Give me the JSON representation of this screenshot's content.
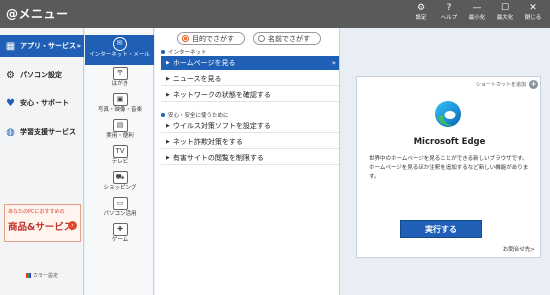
{
  "window": {
    "title": "@メニュー",
    "controls": [
      {
        "name": "settings",
        "label": "設定",
        "icon": "gear-icon"
      },
      {
        "name": "help",
        "label": "ヘルプ",
        "icon": "help-icon"
      },
      {
        "name": "minimize",
        "label": "最小化",
        "icon": "minimize-icon"
      },
      {
        "name": "maximize",
        "label": "最大化",
        "icon": "maximize-icon"
      },
      {
        "name": "close",
        "label": "閉じる",
        "icon": "close-icon"
      }
    ]
  },
  "categories": [
    {
      "label": "アプリ・サービス",
      "icon": "apps-grid-icon",
      "active": true
    },
    {
      "label": "パソコン設定",
      "icon": "gear-icon",
      "active": false
    },
    {
      "label": "安心・サポート",
      "icon": "heart-icon",
      "active": false
    },
    {
      "label": "学習支援サービス",
      "icon": "globe-icon",
      "active": false
    }
  ],
  "ad": {
    "top_text": "あなたのPCにおすすめの",
    "main_text": "商品&サービス",
    "arrow": "›"
  },
  "color_setting": "カラー設定",
  "subcategories": [
    {
      "label": "インターネット・メール",
      "icon": "globe-mail-icon",
      "active": true
    },
    {
      "label": "はがき",
      "icon": "postcard-icon",
      "active": false
    },
    {
      "label": "写真・映像・音楽",
      "icon": "photo-icon",
      "active": false
    },
    {
      "label": "実用・便利",
      "icon": "toolbox-icon",
      "active": false
    },
    {
      "label": "テレビ",
      "icon": "tv-icon",
      "active": false
    },
    {
      "label": "ショッピング",
      "icon": "cart-icon",
      "active": false
    },
    {
      "label": "パソコン活用",
      "icon": "pc-icon",
      "active": false
    },
    {
      "label": "ゲーム",
      "icon": "gamepad-icon",
      "active": false
    }
  ],
  "search_modes": {
    "purpose_label": "目的でさがす",
    "name_label": "名前でさがす",
    "selected": "purpose"
  },
  "sections": [
    {
      "heading": "インターネット",
      "items": [
        {
          "label": "ホームページを見る",
          "active": true
        },
        {
          "label": "ニュースを見る",
          "active": false
        },
        {
          "label": "ネットワークの状態を確認する",
          "active": false
        }
      ]
    },
    {
      "heading": "安心・安全に使うために",
      "items": [
        {
          "label": "ウイルス対策ソフトを設定する",
          "active": false
        },
        {
          "label": "ネット詐欺対策をする",
          "active": false
        },
        {
          "label": "有害サイトの閲覧を制限する",
          "active": false
        }
      ]
    }
  ],
  "detail": {
    "shortcut_label": "ショートカットを追加",
    "app_name": "Microsoft Edge",
    "app_icon": "edge-logo-icon",
    "description": "世界中のホームページを見ることができる新しいブラウザです。ホームページを見るほか注釈を追加するなど新しい機能があります。",
    "run_label": "実行する",
    "contact_label": "お問合せ先>"
  },
  "colors": {
    "accent": "#1f5fb6",
    "titlebar": "#5a5a5a",
    "radio_selected": "#e86a20"
  }
}
